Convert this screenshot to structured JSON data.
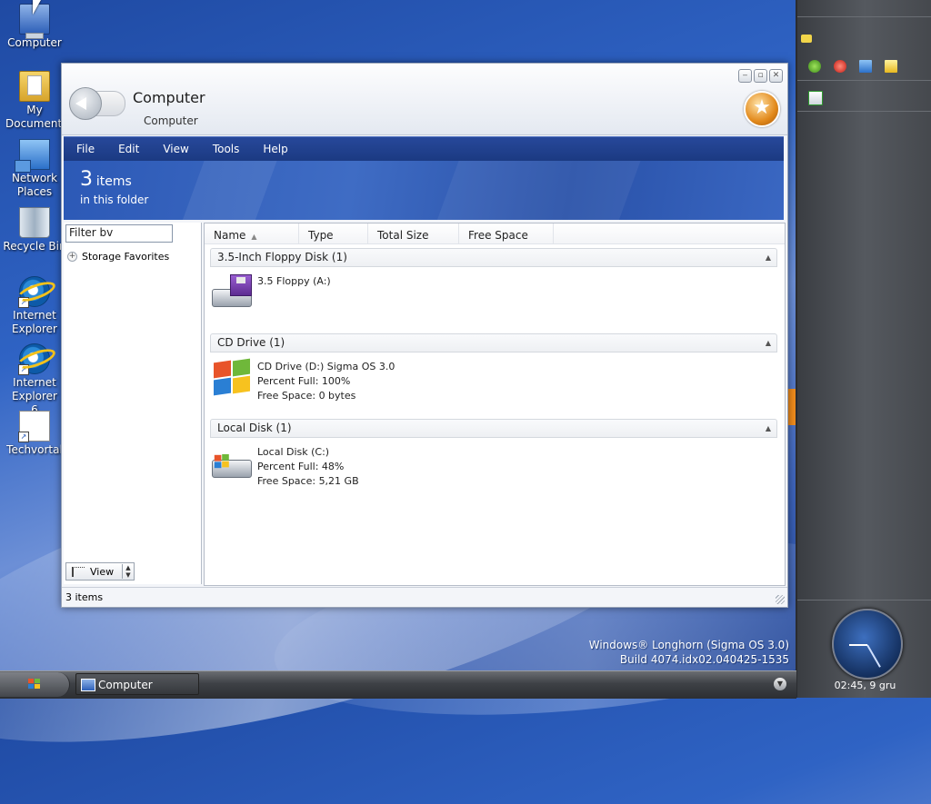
{
  "desktop": {
    "icons": [
      {
        "label": "Computer"
      },
      {
        "label": "My Documents"
      },
      {
        "label": "Network Places"
      },
      {
        "label": "Recycle Bin"
      },
      {
        "label": "Internet Explorer"
      },
      {
        "label": "Internet Explorer 6"
      },
      {
        "label": "Techvortal"
      }
    ],
    "build_line1": "Windows® Longhorn (Sigma OS 3.0)",
    "build_line2": "Build 4074.idx02.040425-1535"
  },
  "window": {
    "title": "Computer",
    "subtitle": "Computer",
    "controls": {
      "minimize": "‒",
      "restore": "▫",
      "close": "✕"
    },
    "menu": [
      "File",
      "Edit",
      "View",
      "Tools",
      "Help"
    ],
    "banner": {
      "count": "3",
      "unit": "items",
      "subtitle": "in this folder"
    },
    "left_pane": {
      "filter_value": "Filter bv",
      "favorites_label": "Storage Favorites",
      "view_label": "View"
    },
    "columns": [
      "Name",
      "Type",
      "Total Size",
      "Free Space"
    ],
    "groups": [
      {
        "header": "3.5-Inch Floppy Disk (1)",
        "icon": "floppy-drive-icon",
        "lines": [
          "3.5 Floppy (A:)"
        ]
      },
      {
        "header": "CD Drive (1)",
        "icon": "windows-flag-icon",
        "lines": [
          "CD Drive (D:) Sigma OS 3.0",
          "Percent Full: 100%",
          "Free Space: 0 bytes"
        ]
      },
      {
        "header": "Local Disk (1)",
        "icon": "local-disk-icon",
        "lines": [
          "Local Disk (C:)",
          "Percent Full: 48%",
          "Free Space: 5,21 GB"
        ]
      }
    ],
    "status_text": "3 items"
  },
  "taskbar": {
    "task_label": "Computer"
  },
  "sidebar": {
    "clock_text": "02:45, 9 gru"
  },
  "colors": {
    "menubar": "#1b3a82",
    "banner": "#3f6cc4",
    "sidebar": "#55595f"
  }
}
